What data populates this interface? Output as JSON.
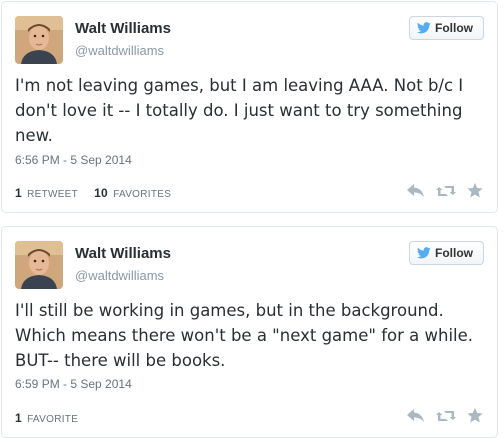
{
  "tweets": [
    {
      "display_name": "Walt Williams",
      "screen_name": "@waltdwilliams",
      "follow_label": "Follow",
      "text": "I'm not leaving games, but I am leaving AAA. Not b/c I don't love it -- I totally do. I just want to try something new.",
      "timestamp": "6:56 PM - 5 Sep 2014",
      "retweet_count": "1",
      "retweet_label": "RETWEET",
      "favorite_count": "10",
      "favorite_label": "FAVORITES"
    },
    {
      "display_name": "Walt Williams",
      "screen_name": "@waltdwilliams",
      "follow_label": "Follow",
      "text": "I'll still be working in games, but in the background. Which means there won't be a \"next game\" for a while. BUT-- there will be books.",
      "timestamp": "6:59 PM - 5 Sep 2014",
      "favorite_count": "1",
      "favorite_label": "FAVORITE"
    }
  ],
  "icons": {
    "bird": "twitter-bird-icon",
    "reply": "reply-icon",
    "retweet": "retweet-icon",
    "favorite": "star-icon"
  },
  "colors": {
    "brand_blue": "#55acee",
    "action_gray": "#aab8c2",
    "text": "#292f33",
    "muted": "#66757f"
  }
}
